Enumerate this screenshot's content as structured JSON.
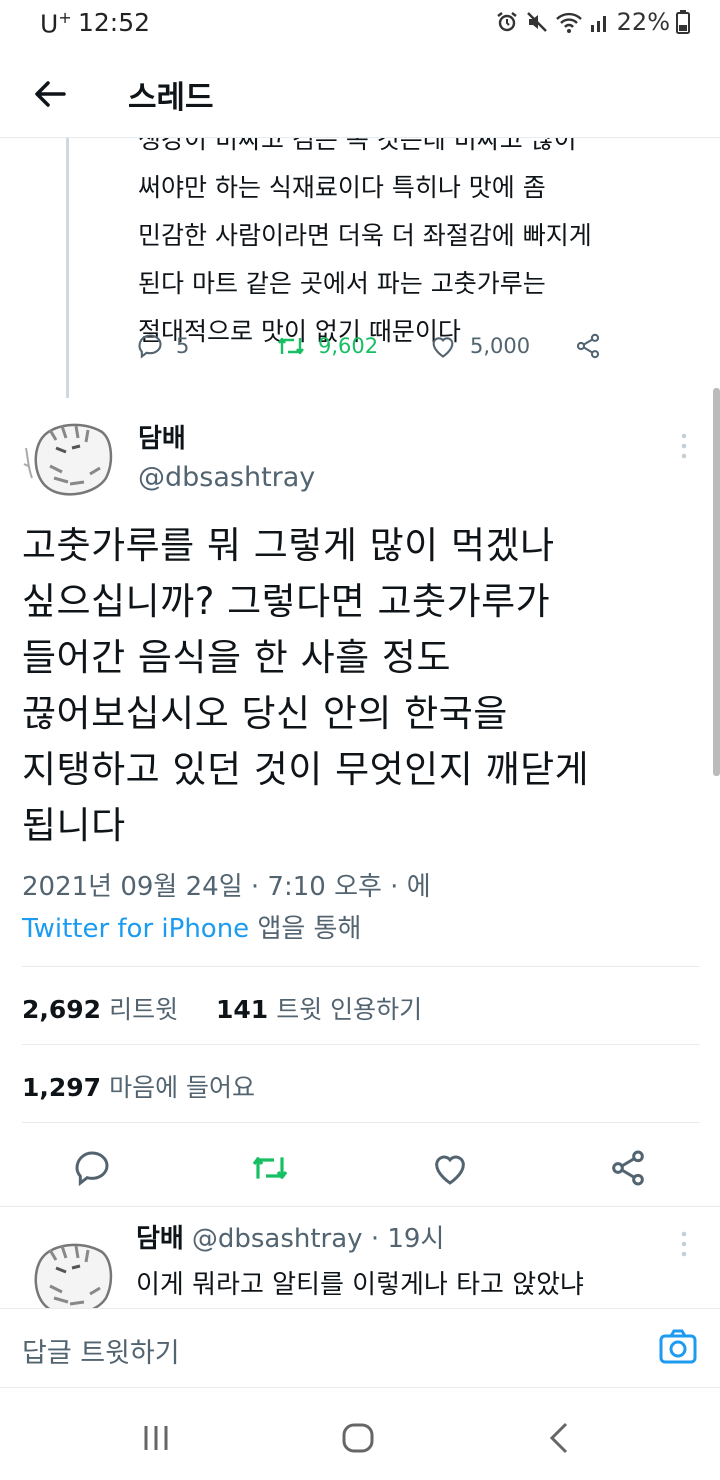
{
  "status_bar": {
    "carrier": "U",
    "carrier_sup": "+",
    "time": "12:52",
    "battery": "22%"
  },
  "header": {
    "title": "스레드"
  },
  "previous_tweet": {
    "text_lines": [
      "생강이 비싸고 검은 녹 것은데 비싸고 많이",
      "써야만 하는 식재료이다 특히나 맛에 좀",
      "민감한 사람이라면 더욱 더 좌절감에 빠지게",
      "된다 마트 같은 곳에서 파는 고춧가루는",
      "절대적으로 맛이 없기 때문이다"
    ],
    "replies": "5",
    "retweets": "9,602",
    "likes": "5,000"
  },
  "main_tweet": {
    "name": "담배",
    "handle": "@dbsashtray",
    "text_lines": [
      "고춧가루를 뭐 그렇게 많이 먹겠나",
      "싶으십니까? 그렇다면 고춧가루가",
      "들어간 음식을 한 사흘 정도",
      "끊어보십시오 당신 안의 한국을",
      "지탱하고 있던 것이 무엇인지 깨닫게",
      "됩니다"
    ],
    "datetime": "2021년 09월 24일 · 7:10 오후 · 에",
    "source": "Twitter for iPhone",
    "source_suffix": "앱을 통해",
    "retweet_count": "2,692",
    "retweet_label": "리트윗",
    "quote_count": "141",
    "quote_label": "트윗 인용하기",
    "like_count": "1,297",
    "like_label": "마음에 들어요"
  },
  "reply_tweet": {
    "name": "담배",
    "handle": "@dbsashtray",
    "time": "· 19시",
    "text": "이게 뭐라고 알티를 이렇게나 타고 앉았냐"
  },
  "reply_bar": {
    "placeholder": "답글 트윗하기"
  },
  "icons": {
    "accent": "#1d9bf0",
    "retweet_color": "#17bf63",
    "names": [
      "back-arrow-icon",
      "reply-icon",
      "retweet-icon",
      "like-icon",
      "share-icon",
      "more-icon",
      "camera-icon",
      "recent-apps-icon",
      "home-icon",
      "nav-back-icon"
    ]
  }
}
